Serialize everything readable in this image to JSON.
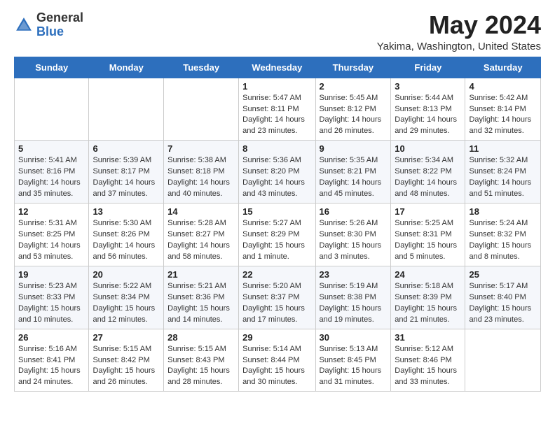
{
  "logo": {
    "general": "General",
    "blue": "Blue"
  },
  "title": "May 2024",
  "subtitle": "Yakima, Washington, United States",
  "days_of_week": [
    "Sunday",
    "Monday",
    "Tuesday",
    "Wednesday",
    "Thursday",
    "Friday",
    "Saturday"
  ],
  "weeks": [
    [
      {
        "day": "",
        "info": ""
      },
      {
        "day": "",
        "info": ""
      },
      {
        "day": "",
        "info": ""
      },
      {
        "day": "1",
        "info": "Sunrise: 5:47 AM\nSunset: 8:11 PM\nDaylight: 14 hours\nand 23 minutes."
      },
      {
        "day": "2",
        "info": "Sunrise: 5:45 AM\nSunset: 8:12 PM\nDaylight: 14 hours\nand 26 minutes."
      },
      {
        "day": "3",
        "info": "Sunrise: 5:44 AM\nSunset: 8:13 PM\nDaylight: 14 hours\nand 29 minutes."
      },
      {
        "day": "4",
        "info": "Sunrise: 5:42 AM\nSunset: 8:14 PM\nDaylight: 14 hours\nand 32 minutes."
      }
    ],
    [
      {
        "day": "5",
        "info": "Sunrise: 5:41 AM\nSunset: 8:16 PM\nDaylight: 14 hours\nand 35 minutes."
      },
      {
        "day": "6",
        "info": "Sunrise: 5:39 AM\nSunset: 8:17 PM\nDaylight: 14 hours\nand 37 minutes."
      },
      {
        "day": "7",
        "info": "Sunrise: 5:38 AM\nSunset: 8:18 PM\nDaylight: 14 hours\nand 40 minutes."
      },
      {
        "day": "8",
        "info": "Sunrise: 5:36 AM\nSunset: 8:20 PM\nDaylight: 14 hours\nand 43 minutes."
      },
      {
        "day": "9",
        "info": "Sunrise: 5:35 AM\nSunset: 8:21 PM\nDaylight: 14 hours\nand 45 minutes."
      },
      {
        "day": "10",
        "info": "Sunrise: 5:34 AM\nSunset: 8:22 PM\nDaylight: 14 hours\nand 48 minutes."
      },
      {
        "day": "11",
        "info": "Sunrise: 5:32 AM\nSunset: 8:24 PM\nDaylight: 14 hours\nand 51 minutes."
      }
    ],
    [
      {
        "day": "12",
        "info": "Sunrise: 5:31 AM\nSunset: 8:25 PM\nDaylight: 14 hours\nand 53 minutes."
      },
      {
        "day": "13",
        "info": "Sunrise: 5:30 AM\nSunset: 8:26 PM\nDaylight: 14 hours\nand 56 minutes."
      },
      {
        "day": "14",
        "info": "Sunrise: 5:28 AM\nSunset: 8:27 PM\nDaylight: 14 hours\nand 58 minutes."
      },
      {
        "day": "15",
        "info": "Sunrise: 5:27 AM\nSunset: 8:29 PM\nDaylight: 15 hours\nand 1 minute."
      },
      {
        "day": "16",
        "info": "Sunrise: 5:26 AM\nSunset: 8:30 PM\nDaylight: 15 hours\nand 3 minutes."
      },
      {
        "day": "17",
        "info": "Sunrise: 5:25 AM\nSunset: 8:31 PM\nDaylight: 15 hours\nand 5 minutes."
      },
      {
        "day": "18",
        "info": "Sunrise: 5:24 AM\nSunset: 8:32 PM\nDaylight: 15 hours\nand 8 minutes."
      }
    ],
    [
      {
        "day": "19",
        "info": "Sunrise: 5:23 AM\nSunset: 8:33 PM\nDaylight: 15 hours\nand 10 minutes."
      },
      {
        "day": "20",
        "info": "Sunrise: 5:22 AM\nSunset: 8:34 PM\nDaylight: 15 hours\nand 12 minutes."
      },
      {
        "day": "21",
        "info": "Sunrise: 5:21 AM\nSunset: 8:36 PM\nDaylight: 15 hours\nand 14 minutes."
      },
      {
        "day": "22",
        "info": "Sunrise: 5:20 AM\nSunset: 8:37 PM\nDaylight: 15 hours\nand 17 minutes."
      },
      {
        "day": "23",
        "info": "Sunrise: 5:19 AM\nSunset: 8:38 PM\nDaylight: 15 hours\nand 19 minutes."
      },
      {
        "day": "24",
        "info": "Sunrise: 5:18 AM\nSunset: 8:39 PM\nDaylight: 15 hours\nand 21 minutes."
      },
      {
        "day": "25",
        "info": "Sunrise: 5:17 AM\nSunset: 8:40 PM\nDaylight: 15 hours\nand 23 minutes."
      }
    ],
    [
      {
        "day": "26",
        "info": "Sunrise: 5:16 AM\nSunset: 8:41 PM\nDaylight: 15 hours\nand 24 minutes."
      },
      {
        "day": "27",
        "info": "Sunrise: 5:15 AM\nSunset: 8:42 PM\nDaylight: 15 hours\nand 26 minutes."
      },
      {
        "day": "28",
        "info": "Sunrise: 5:15 AM\nSunset: 8:43 PM\nDaylight: 15 hours\nand 28 minutes."
      },
      {
        "day": "29",
        "info": "Sunrise: 5:14 AM\nSunset: 8:44 PM\nDaylight: 15 hours\nand 30 minutes."
      },
      {
        "day": "30",
        "info": "Sunrise: 5:13 AM\nSunset: 8:45 PM\nDaylight: 15 hours\nand 31 minutes."
      },
      {
        "day": "31",
        "info": "Sunrise: 5:12 AM\nSunset: 8:46 PM\nDaylight: 15 hours\nand 33 minutes."
      },
      {
        "day": "",
        "info": ""
      }
    ]
  ]
}
